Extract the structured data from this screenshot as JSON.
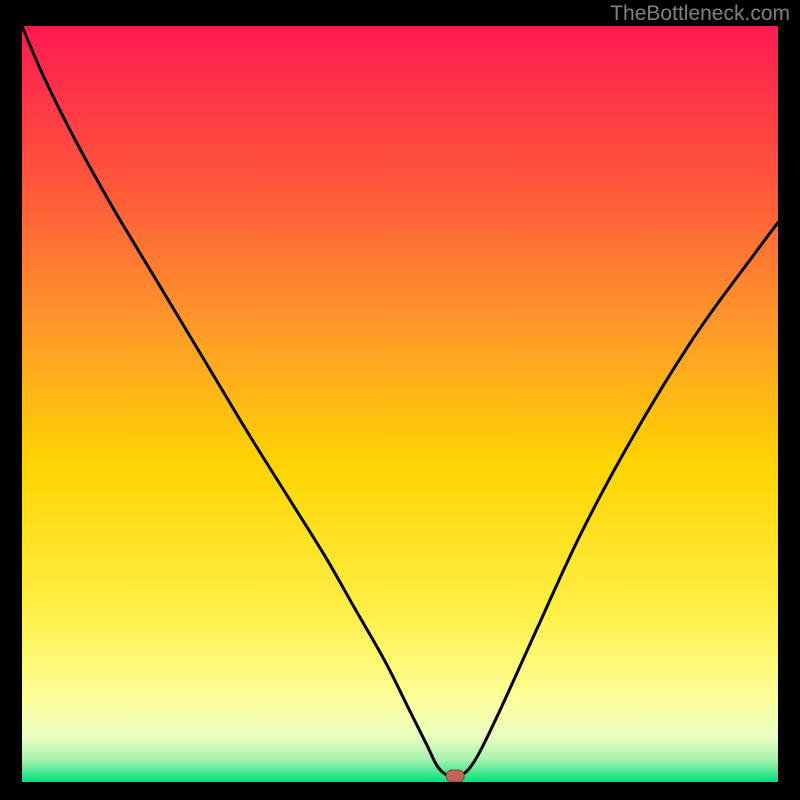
{
  "watermark": "TheBottleneck.com",
  "colors": {
    "bg": "#000000",
    "curve": "#000000",
    "marker_fill": "#c1645a",
    "marker_stroke": "#8b3f36",
    "grad_top": "#ff1a52",
    "grad_mid_upper": "#ff7f2a",
    "grad_mid": "#ffd400",
    "grad_mid_lower": "#fff66a",
    "grad_near_bottom": "#f4ffb3",
    "grad_green1": "#7de38f",
    "grad_green2": "#00e17a"
  },
  "chart_data": {
    "type": "line",
    "title": "",
    "xlabel": "",
    "ylabel": "",
    "xlim": [
      0,
      100
    ],
    "ylim": [
      0,
      100
    ],
    "x": [
      0,
      3,
      7,
      12,
      18,
      24,
      30,
      35,
      40,
      44,
      48,
      51,
      53.5,
      55,
      56.5,
      58,
      60,
      63,
      68,
      74,
      81,
      89,
      97,
      100
    ],
    "values": [
      100,
      93,
      85,
      76,
      66,
      56,
      46,
      38,
      30,
      23,
      16,
      10,
      5,
      2,
      0.8,
      0.8,
      3,
      9,
      20,
      33,
      46,
      59,
      70,
      74
    ],
    "marker": {
      "x": 57.3,
      "y": 0.8
    }
  }
}
